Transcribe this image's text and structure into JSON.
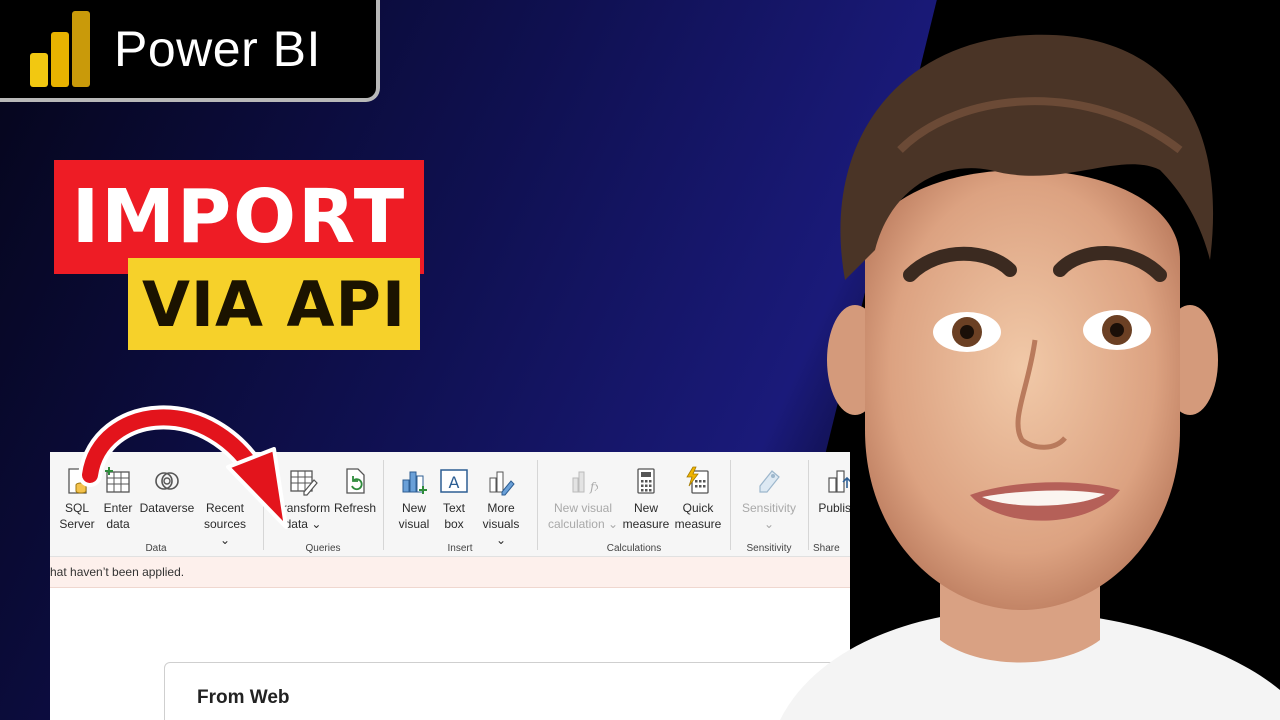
{
  "badge": {
    "text": "Power BI",
    "logo_icon": "power-bi-logo"
  },
  "title": {
    "line1": "IMPORT",
    "line2": "VIA API",
    "line1_bg": "#ee1c25",
    "line2_bg": "#f6d12a"
  },
  "ribbon": {
    "groups": [
      {
        "label": "Data",
        "tools": [
          {
            "label_line1": "SQL",
            "label_line2": "Server",
            "icon": "sql-server-icon"
          },
          {
            "label_line1": "Enter",
            "label_line2": "data",
            "icon": "table-add-icon"
          },
          {
            "label_line1": "Dataverse",
            "label_line2": "",
            "icon": "dataverse-icon"
          },
          {
            "label_line1": "Recent",
            "label_line2": "sources ⌄",
            "icon": "recent-sources-icon"
          }
        ]
      },
      {
        "label": "Queries",
        "tools": [
          {
            "label_line1": "Transform",
            "label_line2": "data ⌄",
            "icon": "transform-data-icon"
          },
          {
            "label_line1": "Refresh",
            "label_line2": "",
            "icon": "refresh-icon"
          }
        ]
      },
      {
        "label": "Insert",
        "tools": [
          {
            "label_line1": "New",
            "label_line2": "visual",
            "icon": "new-visual-icon"
          },
          {
            "label_line1": "Text",
            "label_line2": "box",
            "icon": "text-box-icon"
          },
          {
            "label_line1": "More",
            "label_line2": "visuals ⌄",
            "icon": "more-visuals-icon"
          }
        ]
      },
      {
        "label": "Calculations",
        "tools": [
          {
            "label_line1": "New visual",
            "label_line2": "calculation ⌄",
            "icon": "visual-calculation-icon"
          },
          {
            "label_line1": "New",
            "label_line2": "measure",
            "icon": "calculator-icon"
          },
          {
            "label_line1": "Quick",
            "label_line2": "measure",
            "icon": "quick-measure-icon"
          }
        ]
      },
      {
        "label": "Sensitivity",
        "tools": [
          {
            "label_line1": "Sensitivity",
            "label_line2": "⌄",
            "icon": "sensitivity-icon"
          }
        ]
      },
      {
        "label": "Share",
        "tools": [
          {
            "label_line1": "Publish",
            "label_line2": "",
            "icon": "publish-icon"
          }
        ]
      }
    ]
  },
  "notice": {
    "text": "hat haven’t been applied."
  },
  "dialog": {
    "title": "From Web"
  }
}
